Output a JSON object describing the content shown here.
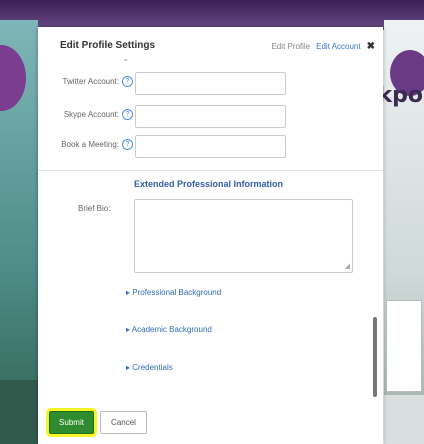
{
  "background": {
    "sign_text": "kpo"
  },
  "modal": {
    "title": "Edit Profile Settings",
    "tabs": [
      {
        "label": "Edit Profile"
      },
      {
        "label": "Edit Account"
      }
    ],
    "close_glyph": "✖",
    "collapse_glyph": "⌄"
  },
  "fields": [
    {
      "label": "Twitter Account:",
      "value": "",
      "help_glyph": "?"
    },
    {
      "label": "Skype Account:",
      "value": "",
      "help_glyph": "?"
    },
    {
      "label": "Book a Meeting:",
      "value": "",
      "help_glyph": "?"
    }
  ],
  "extended": {
    "title": "Extended Professional Information",
    "bio_label": "Brief Bio:"
  },
  "toggles": [
    {
      "label": "Professional Background"
    },
    {
      "label": "Academic Background"
    },
    {
      "label": "Credentials"
    }
  ],
  "buttons": {
    "submit": "Submit",
    "cancel": "Cancel"
  },
  "colors": {
    "submit_bg": "#2e8b2e",
    "highlight": "#f7f526",
    "link": "#2f6db5",
    "section_title": "#2f5fa5"
  }
}
